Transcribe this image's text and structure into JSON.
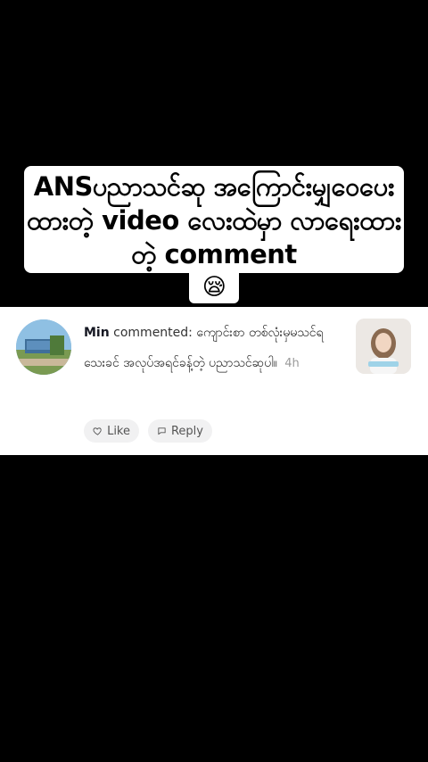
{
  "caption": {
    "text": "ANSပညာသင်ဆု အကြောင်းမျှဝေပေးထားတဲ့ video လေးထဲမှာ လာရေးထားတဲ့ comment",
    "emoji": "😪"
  },
  "comment": {
    "author": "Min",
    "verb": "commented:",
    "text": "ကျောင်းစာ တစ်လုံးမှမသင်ရသေးခင် အလုပ်အရင်ခန့်တဲ့ ပညာသင်ဆုပါ။",
    "time": "4h",
    "like_label": "Like",
    "reply_label": "Reply"
  },
  "colors": {
    "background": "#000000",
    "card": "#ffffff",
    "button_bg": "#f1f1f2"
  },
  "icons": [
    "heart-icon",
    "speech-bubble-icon"
  ]
}
